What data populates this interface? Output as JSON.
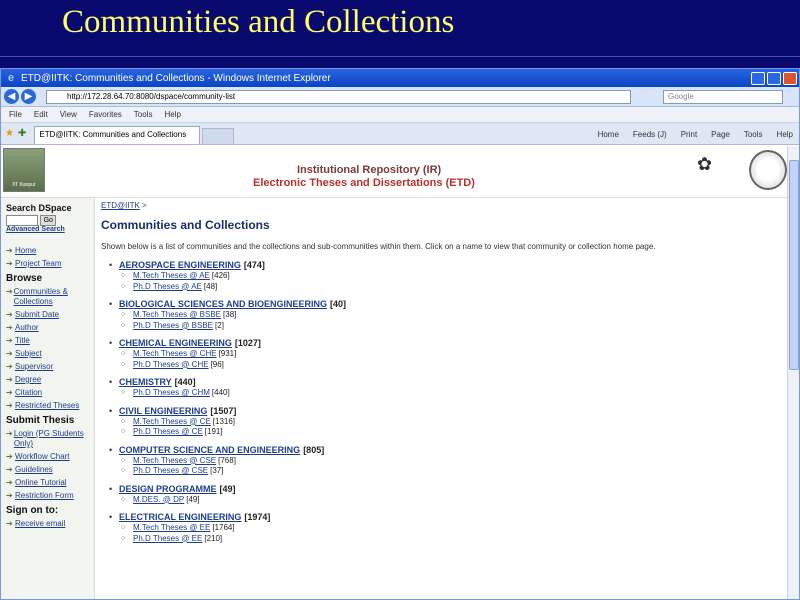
{
  "slide": {
    "title": "Communities and Collections"
  },
  "window": {
    "title": "ETD@IITK: Communities and Collections - Windows Internet Explorer",
    "address": "http://172.28.64.70:8080/dspace/community-list",
    "search_placeholder": "Google",
    "menu": [
      "File",
      "Edit",
      "View",
      "Favorites",
      "Tools",
      "Help"
    ],
    "tab_label": "ETD@IITK: Communities and Collections",
    "commands": [
      "Home",
      "Feeds (J)",
      "Print",
      "Page",
      "Tools",
      "Help"
    ]
  },
  "banner": {
    "line1": "Institutional Repository (IR)",
    "line2": "Electronic Theses and Dissertations (ETD)",
    "photo_caption": "IIT Kanpur"
  },
  "sidebar": {
    "search_head": "Search DSpace",
    "go_label": "Go",
    "advanced": "Advanced Search",
    "top_links": [
      "Home",
      "Project Team"
    ],
    "browse_head": "Browse",
    "browse_links": [
      "Communities & Collections",
      "Submit Date",
      "Author",
      "Title",
      "Subject",
      "Supervisor",
      "Degree",
      "Citation",
      "Restricted Theses"
    ],
    "submit_head": "Submit Thesis",
    "submit_links": [
      "Login (PG Students Only)",
      "Workflow Chart",
      "Guidelines",
      "Online Tutorial",
      "Restriction Form"
    ],
    "signon_head": "Sign on to:",
    "signon_links": [
      "Receive email"
    ]
  },
  "main": {
    "breadcrumb_link": "ETD@IITK",
    "breadcrumb_sep": ">",
    "title": "Communities and Collections",
    "intro": "Shown below is a list of communities and the collections and sub-communities within them. Click on a name to view that community or collection home page.",
    "communities": [
      {
        "name": "AEROSPACE ENGINEERING",
        "count": "[474]",
        "subs": [
          {
            "name": "M.Tech Theses @ AE",
            "count": "[426]"
          },
          {
            "name": "Ph.D Theses @ AE",
            "count": "[48]"
          }
        ]
      },
      {
        "name": "BIOLOGICAL SCIENCES AND BIOENGINEERING",
        "count": "[40]",
        "subs": [
          {
            "name": "M.Tech Theses @ BSBE",
            "count": "[38]"
          },
          {
            "name": "Ph.D Theses @ BSBE",
            "count": "[2]"
          }
        ]
      },
      {
        "name": "CHEMICAL ENGINEERING",
        "count": "[1027]",
        "subs": [
          {
            "name": "M.Tech Theses @ CHE",
            "count": "[931]"
          },
          {
            "name": "Ph.D Theses @ CHE",
            "count": "[96]"
          }
        ]
      },
      {
        "name": "CHEMISTRY",
        "count": "[440]",
        "subs": [
          {
            "name": "Ph.D Theses @ CHM",
            "count": "[440]"
          }
        ]
      },
      {
        "name": "CIVIL ENGINEERING",
        "count": "[1507]",
        "subs": [
          {
            "name": "M.Tech Theses @ CE",
            "count": "[1316]"
          },
          {
            "name": "Ph.D Theses @ CE",
            "count": "[191]"
          }
        ]
      },
      {
        "name": "COMPUTER SCIENCE AND ENGINEERING",
        "count": "[805]",
        "subs": [
          {
            "name": "M.Tech Theses @ CSE",
            "count": "[768]"
          },
          {
            "name": "Ph.D Theses @ CSE",
            "count": "[37]"
          }
        ]
      },
      {
        "name": "DESIGN PROGRAMME",
        "count": "[49]",
        "subs": [
          {
            "name": "M.DES. @ DP",
            "count": "[49]"
          }
        ]
      },
      {
        "name": "ELECTRICAL ENGINEERING",
        "count": "[1974]",
        "subs": [
          {
            "name": "M.Tech Theses @ EE",
            "count": "[1764]"
          },
          {
            "name": "Ph.D Theses @ EE",
            "count": "[210]"
          }
        ]
      }
    ]
  }
}
